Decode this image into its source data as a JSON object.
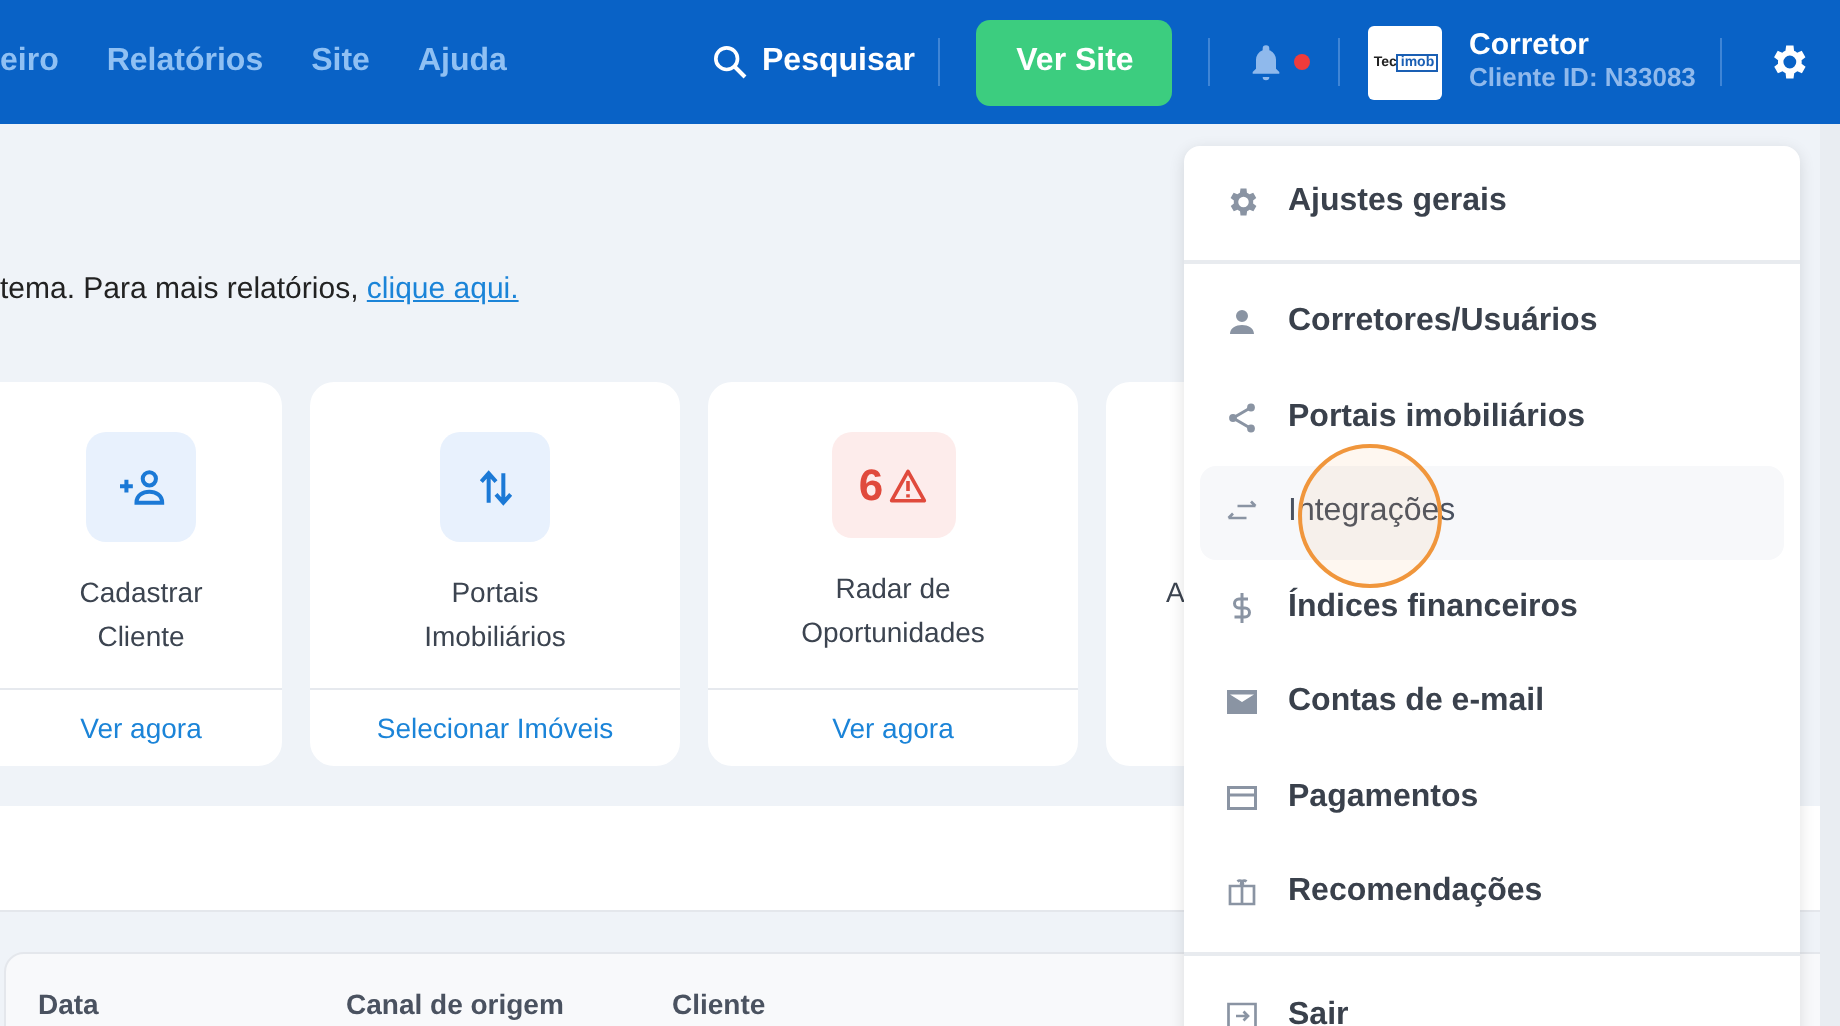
{
  "nav": {
    "items": [
      "eiro",
      "Relatórios",
      "Site",
      "Ajuda"
    ],
    "search": "Pesquisar",
    "view_site": "Ver Site",
    "notifications": {
      "unread": true
    },
    "logo": {
      "left": "Tec",
      "right": "imob"
    },
    "account": {
      "name": "Corretor",
      "client_id": "Cliente ID: N33083"
    }
  },
  "intro": {
    "text": "tema. Para mais relatórios,",
    "link": "clique aqui."
  },
  "cards": [
    {
      "kind": "add-client",
      "title": "Cadastrar Cliente",
      "action": "Ver agora"
    },
    {
      "kind": "portals",
      "title": "Portais Imobiliários",
      "action": "Selecionar Imóveis"
    },
    {
      "kind": "radar",
      "count": "6",
      "title": "Radar de Oportunidades",
      "action": "Ver agora"
    },
    {
      "kind": "partial",
      "title": "A"
    }
  ],
  "table": {
    "columns": [
      "Data",
      "Canal de origem",
      "Cliente"
    ]
  },
  "menu": {
    "groups": [
      [
        {
          "kind": "gear",
          "label": "Ajustes gerais",
          "selected": false
        }
      ],
      [
        {
          "kind": "person",
          "label": "Corretores/Usuários",
          "selected": false
        },
        {
          "kind": "share",
          "label": "Portais imobiliários",
          "selected": false
        },
        {
          "kind": "swap",
          "label": "Integrações",
          "selected": true
        },
        {
          "kind": "dollar",
          "label": "Índices financeiros",
          "selected": false
        },
        {
          "kind": "mail",
          "label": "Contas de e-mail",
          "selected": false
        },
        {
          "kind": "card",
          "label": "Pagamentos",
          "selected": false
        },
        {
          "kind": "gift",
          "label": "Recomendações",
          "selected": false
        }
      ],
      [
        {
          "kind": "exit",
          "label": "Sair",
          "selected": false
        }
      ]
    ]
  }
}
